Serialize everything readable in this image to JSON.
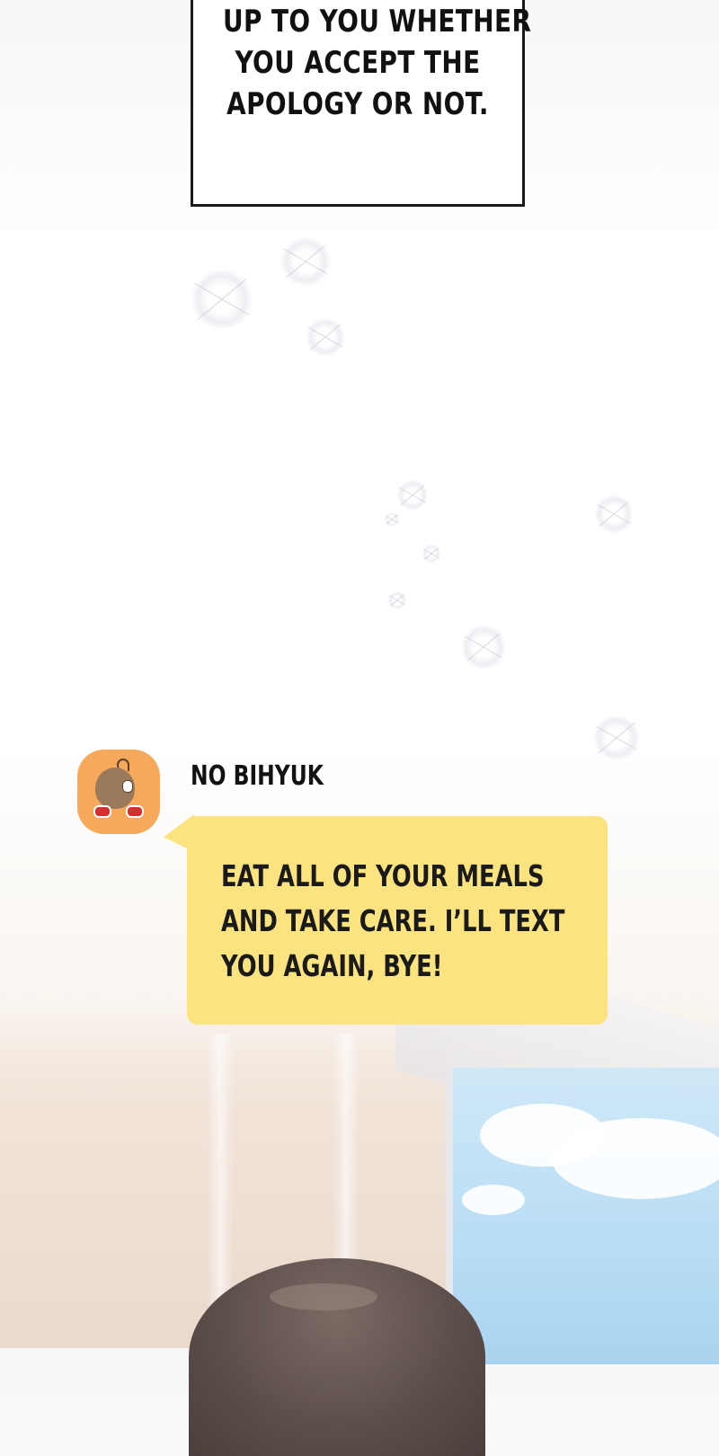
{
  "narration": {
    "lines": [
      "UP TO YOU WHETHER",
      "YOU ACCEPT THE",
      "APOLOGY OR NOT."
    ]
  },
  "chat": {
    "sender_name": "NO BIHYUK",
    "avatar_icon": "potato-mascot-icon",
    "avatar_color": "#f6a95a",
    "bubble_color": "#fbe37f",
    "message_lines": [
      "EAT ALL OF YOUR MEALS",
      "AND TAKE CARE. I’LL TEXT",
      "YOU AGAIN, BYE!"
    ]
  }
}
